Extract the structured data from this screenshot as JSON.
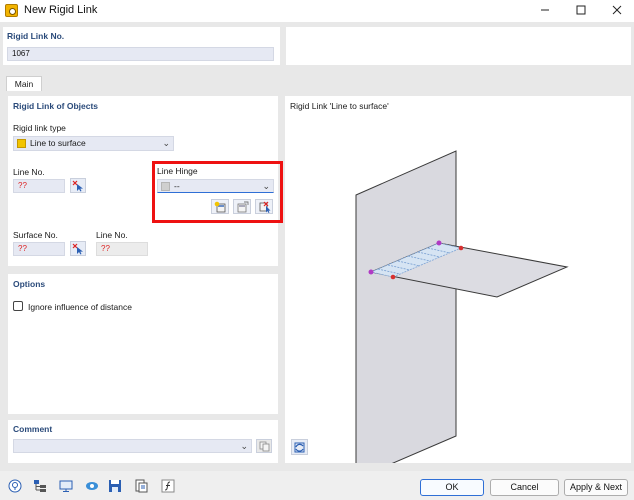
{
  "window": {
    "title": "New Rigid Link"
  },
  "header": {
    "number_label": "Rigid Link No.",
    "number_value": "1067"
  },
  "tabs": [
    {
      "label": "Main"
    }
  ],
  "rigid_link_of_objects": {
    "title": "Rigid Link of Objects",
    "type_label": "Rigid link type",
    "type_value": "Line to surface",
    "type_color": "#f2c400",
    "line_no_label": "Line No.",
    "line_no_value": "??",
    "line_hinge_label": "Line Hinge",
    "line_hinge_value": "--",
    "surface_no_label": "Surface No.",
    "surface_no_value": "??",
    "line_no2_label": "Line No.",
    "line_no2_value": "??"
  },
  "options": {
    "title": "Options",
    "ignore_distance_label": "Ignore influence of distance",
    "ignore_distance_checked": false
  },
  "comment": {
    "title": "Comment",
    "value": ""
  },
  "preview": {
    "title": "Rigid Link 'Line to surface'"
  },
  "buttons": {
    "ok": "OK",
    "cancel": "Cancel",
    "apply_next": "Apply & Next"
  },
  "colors": {
    "accent": "#2f6fd6",
    "highlight": "#ee1111",
    "section_title": "#2a4a7a",
    "missing_value": "#d22222"
  }
}
